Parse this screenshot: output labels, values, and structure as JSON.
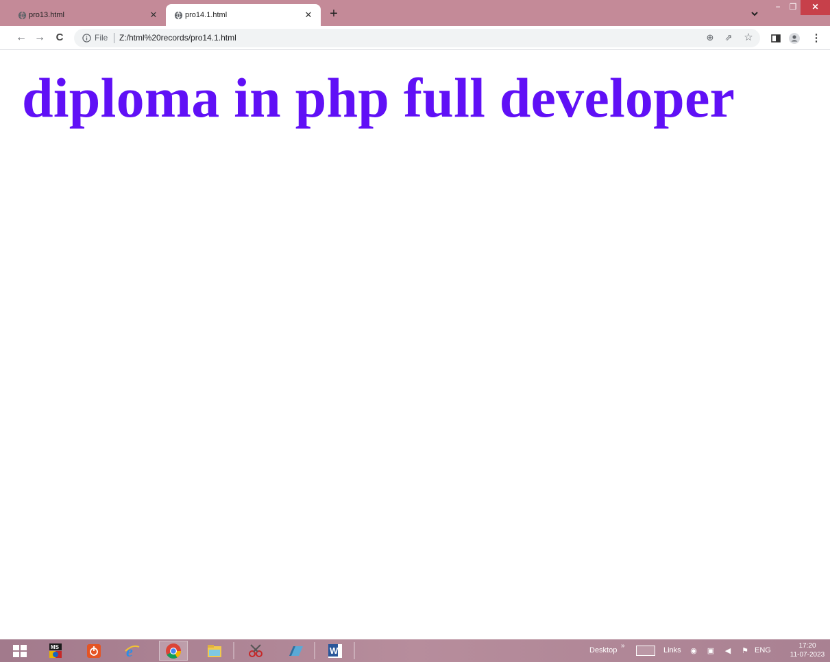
{
  "tabs": [
    {
      "title": "pro13.html",
      "active": false
    },
    {
      "title": "pro14.1.html",
      "active": true
    }
  ],
  "toolbar": {
    "scheme_label": "File",
    "url": "Z:/html%20records/pro14.1.html"
  },
  "page": {
    "heading": "diploma in php full developer",
    "heading_color": "#6010f6"
  },
  "taskbar": {
    "desktop_label": "Desktop",
    "links_label": "Links",
    "language": "ENG",
    "time": "17:20",
    "date": "11-07-2023",
    "pinned": [
      "windows-start",
      "ms-app",
      "power",
      "internet-explorer",
      "chrome",
      "file-explorer",
      "snipping-tool",
      "app",
      "word"
    ]
  },
  "colors": {
    "tabstrip": "#c48a98",
    "close_button": "#c7404a"
  }
}
